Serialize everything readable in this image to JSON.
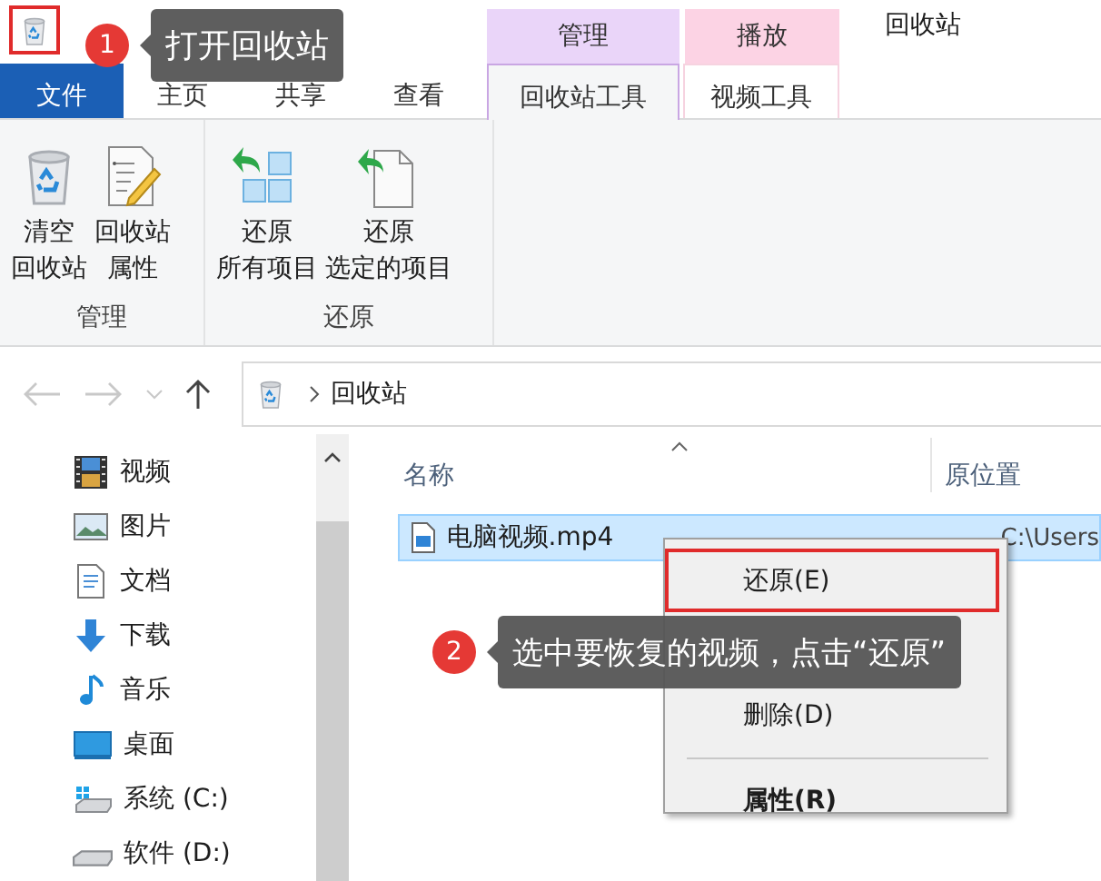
{
  "title_bar": {
    "icon_outlined": true,
    "title": "回收站",
    "tab_groups": [
      {
        "label": "管理",
        "color": "#ead5f9"
      },
      {
        "label": "播放",
        "color": "#fcd3e4"
      }
    ]
  },
  "ribbon_tabs": [
    {
      "label": "文件",
      "kind": "file",
      "selected": false
    },
    {
      "label": "主页",
      "kind": "tab",
      "selected": false
    },
    {
      "label": "共享",
      "kind": "tab",
      "selected": false
    },
    {
      "label": "查看",
      "kind": "tab",
      "selected": false
    },
    {
      "label": "回收站工具",
      "kind": "tab",
      "selected": true
    },
    {
      "label": "视频工具",
      "kind": "tab",
      "selected": false
    }
  ],
  "ribbon_groups": [
    {
      "label": "管理",
      "buttons": [
        {
          "kind": "empty-bin",
          "lines": [
            "清空",
            "回收站"
          ]
        },
        {
          "kind": "properties",
          "lines": [
            "回收站",
            "属性"
          ]
        }
      ]
    },
    {
      "label": "还原",
      "buttons": [
        {
          "kind": "restore-all",
          "lines": [
            "还原",
            "所有项目"
          ]
        },
        {
          "kind": "restore-selected",
          "lines": [
            "还原",
            "选定的项目"
          ]
        }
      ]
    }
  ],
  "address_bar": {
    "path": [
      "回收站"
    ]
  },
  "nav_pane": {
    "items": [
      {
        "kind": "videos",
        "label": "视频"
      },
      {
        "kind": "pictures",
        "label": "图片"
      },
      {
        "kind": "documents",
        "label": "文档"
      },
      {
        "kind": "downloads",
        "label": "下载"
      },
      {
        "kind": "music",
        "label": "音乐"
      },
      {
        "kind": "desktop",
        "label": "桌面"
      },
      {
        "kind": "system-drive",
        "label": "系统 (C:)"
      },
      {
        "kind": "drive",
        "label": "软件 (D:)"
      }
    ]
  },
  "file_list": {
    "columns": [
      "名称",
      "原位置"
    ],
    "rows": [
      {
        "name": "电脑视频.mp4",
        "location": "C:\\Users",
        "selected": true
      }
    ]
  },
  "context_menu": {
    "items": [
      {
        "kind": "item",
        "label": "还原(E)",
        "outlined": true,
        "bold": false
      },
      {
        "kind": "gap"
      },
      {
        "kind": "item",
        "label": "删除(D)",
        "outlined": false,
        "bold": false
      },
      {
        "kind": "separator"
      },
      {
        "kind": "item",
        "label": "属性(R)",
        "outlined": false,
        "bold": true
      }
    ]
  },
  "annotations": [
    {
      "number": "1",
      "text": "打开回收站"
    },
    {
      "number": "2",
      "text": "选中要恢复的视频，点击“还原”"
    }
  ]
}
